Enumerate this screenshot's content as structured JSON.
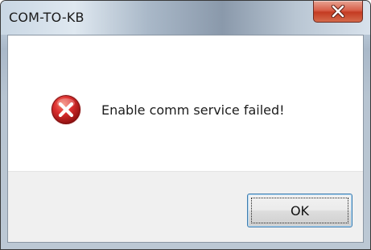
{
  "window": {
    "title": "COM-TO-KB"
  },
  "dialog": {
    "message": "Enable comm service failed!",
    "icon": "error-icon",
    "ok_label": "OK"
  },
  "colors": {
    "close_button": "#c43b22",
    "error_icon": "#d32f2f",
    "button_face": "#e5e5e5",
    "button_border": "#3d7bad"
  }
}
